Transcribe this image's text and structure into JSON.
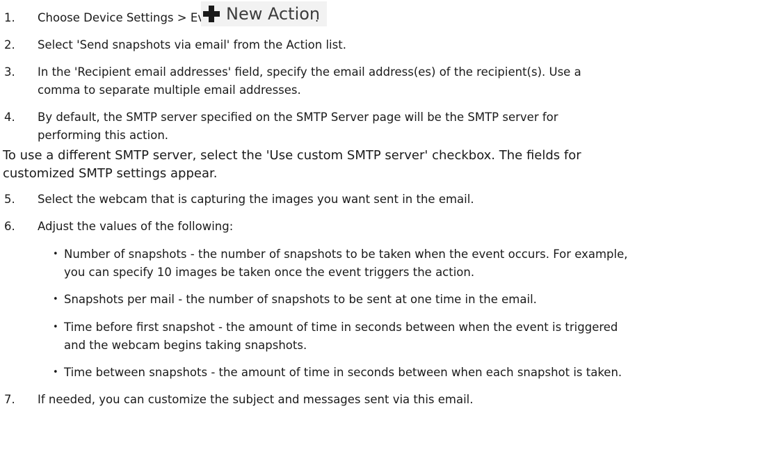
{
  "steps": [
    {
      "num": "1.",
      "text": "Choose Device Settings > Event Rules >",
      "button_label": "New Action",
      "trail": "."
    },
    {
      "num": "2.",
      "text": "Select 'Send snapshots via email' from the Action list."
    },
    {
      "num": "3.",
      "lines": [
        "In the 'Recipient email addresses' field, specify the email address(es) of the recipient(s). Use a",
        "comma to separate multiple email addresses."
      ]
    },
    {
      "num": "4.",
      "lines": [
        "By default, the SMTP server specified on the SMTP Server page will be the SMTP server for",
        "performing this action."
      ]
    },
    {
      "num": "5.",
      "text": "Select the webcam that is capturing the images you want sent in the email."
    },
    {
      "num": "6.",
      "text": "Adjust the values of the following:"
    },
    {
      "num": "7.",
      "text": "If needed, you can customize the subject and messages sent via this email."
    }
  ],
  "note_lines": [
    "To use a different SMTP server, select the 'Use custom SMTP server' checkbox. The fields for",
    "customized SMTP settings appear."
  ],
  "bullets": [
    {
      "lines": [
        "Number of snapshots - the number of snapshots to be taken when the event occurs. For example,",
        "you can specify 10 images be taken once the event triggers the action."
      ]
    },
    {
      "lines": [
        "Snapshots per mail - the number of snapshots to be sent at one time in the email."
      ]
    },
    {
      "lines": [
        "Time before first snapshot - the amount of time in seconds between when the event is triggered",
        "and the webcam begins taking snapshots."
      ]
    },
    {
      "lines": [
        "Time between snapshots - the amount of time in seconds between when each snapshot is taken."
      ]
    }
  ],
  "bullet_glyph": "•"
}
